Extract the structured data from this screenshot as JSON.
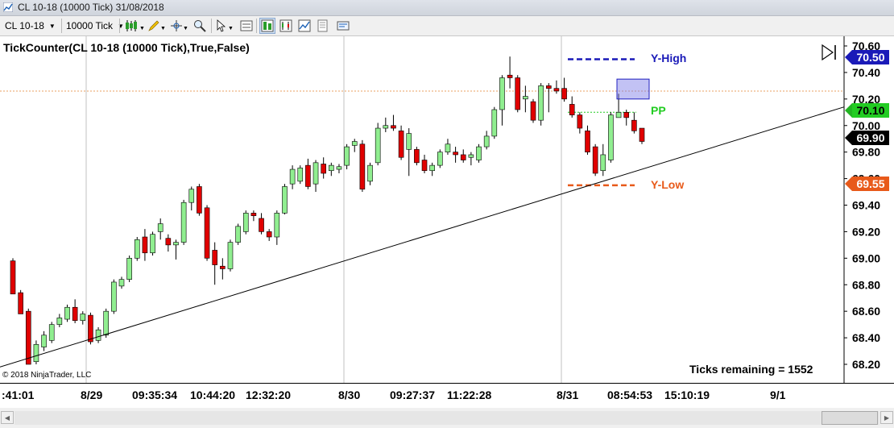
{
  "window": {
    "title": "CL 10-18 (10000 Tick)  31/08/2018"
  },
  "toolbar": {
    "instrument": "CL 10-18",
    "interval": "10000 Tick",
    "tools": [
      "candlestick-style-icon",
      "pencil-draw-icon",
      "crosshair-icon",
      "zoom-icon",
      "pointer-icon",
      "data-box-icon",
      "chart-trader-icon",
      "strategy-icon",
      "indicators-icon",
      "properties-icon"
    ]
  },
  "chart": {
    "title": "TickCounter(CL 10-18 (10000 Tick),True,False)",
    "copyright": "© 2018 NinjaTrader, LLC",
    "ticks_remaining": "Ticks remaining = 1552",
    "price_labels": [
      "70.60",
      "70.40",
      "70.20",
      "70.00",
      "69.80",
      "69.60",
      "69.40",
      "69.20",
      "69.00",
      "68.80",
      "68.60",
      "68.40",
      "68.20"
    ],
    "time_labels": [
      ":41:01",
      "8/29",
      "09:35:34",
      "10:44:20",
      "12:32:20",
      "8/30",
      "09:27:37",
      "11:22:28",
      "8/31",
      "08:54:53",
      "15:10:19",
      "9/1"
    ],
    "markers": {
      "y_high": {
        "label": "Y-High",
        "value": "70.50",
        "color": "#1a1ab8"
      },
      "pp": {
        "label": "PP",
        "value": "70.10",
        "color": "#22b422"
      },
      "last": {
        "value": "69.90",
        "color": "#000000"
      },
      "y_low": {
        "label": "Y-Low",
        "value": "69.55",
        "color": "#e85a1a"
      }
    },
    "colors": {
      "up": "#90ee90",
      "down": "#e00000",
      "wick": "#000000"
    }
  },
  "chart_data": {
    "type": "candlestick",
    "title": "TickCounter(CL 10-18 (10000 Tick),True,False)",
    "ylim": [
      68.1,
      70.65
    ],
    "y_ticks": [
      70.6,
      70.4,
      70.2,
      70.0,
      69.8,
      69.6,
      69.4,
      69.2,
      69.0,
      68.8,
      68.6,
      68.4,
      68.2
    ],
    "x_labels": [
      ":41:01",
      "8/29",
      "09:35:34",
      "10:44:20",
      "12:32:20",
      "8/30",
      "09:27:37",
      "11:22:28",
      "8/31",
      "08:54:53",
      "15:10:19",
      "9/1"
    ],
    "candles": [
      [
        68.98,
        69.0,
        68.75,
        68.73
      ],
      [
        68.74,
        68.76,
        68.6,
        68.58
      ],
      [
        68.6,
        68.62,
        68.22,
        68.2
      ],
      [
        68.22,
        68.38,
        68.2,
        68.35
      ],
      [
        68.33,
        68.45,
        68.3,
        68.42
      ],
      [
        68.38,
        68.52,
        68.36,
        68.5
      ],
      [
        68.5,
        68.58,
        68.48,
        68.55
      ],
      [
        68.54,
        68.65,
        68.52,
        68.63
      ],
      [
        68.63,
        68.69,
        68.51,
        68.53
      ],
      [
        68.53,
        68.6,
        68.5,
        68.58
      ],
      [
        68.57,
        68.59,
        68.35,
        68.37
      ],
      [
        68.38,
        68.48,
        68.36,
        68.46
      ],
      [
        68.42,
        68.62,
        68.4,
        68.6
      ],
      [
        68.6,
        68.84,
        68.58,
        68.82
      ],
      [
        68.79,
        68.86,
        68.77,
        68.84
      ],
      [
        68.84,
        69.02,
        68.82,
        69.0
      ],
      [
        69.0,
        69.16,
        68.98,
        69.14
      ],
      [
        69.16,
        69.22,
        68.98,
        69.04
      ],
      [
        69.04,
        69.2,
        69.02,
        69.18
      ],
      [
        69.2,
        69.3,
        69.14,
        69.26
      ],
      [
        69.15,
        69.18,
        69.05,
        69.1
      ],
      [
        69.1,
        69.14,
        68.99,
        69.12
      ],
      [
        69.12,
        69.44,
        69.1,
        69.42
      ],
      [
        69.42,
        69.54,
        69.36,
        69.52
      ],
      [
        69.54,
        69.56,
        69.32,
        69.34
      ],
      [
        69.38,
        69.4,
        68.98,
        69.0
      ],
      [
        69.06,
        69.12,
        68.8,
        68.95
      ],
      [
        68.94,
        69.0,
        68.84,
        68.92
      ],
      [
        68.92,
        69.14,
        68.9,
        69.12
      ],
      [
        69.12,
        69.26,
        69.1,
        69.24
      ],
      [
        69.2,
        69.36,
        69.18,
        69.34
      ],
      [
        69.34,
        69.36,
        69.28,
        69.32
      ],
      [
        69.3,
        69.34,
        69.18,
        69.2
      ],
      [
        69.2,
        69.22,
        69.13,
        69.16
      ],
      [
        69.16,
        69.36,
        69.1,
        69.34
      ],
      [
        69.34,
        69.56,
        69.33,
        69.54
      ],
      [
        69.56,
        69.7,
        69.52,
        69.67
      ],
      [
        69.58,
        69.7,
        69.56,
        69.68
      ],
      [
        69.7,
        69.75,
        69.52,
        69.54
      ],
      [
        69.56,
        69.74,
        69.5,
        69.72
      ],
      [
        69.71,
        69.76,
        69.6,
        69.64
      ],
      [
        69.66,
        69.72,
        69.62,
        69.7
      ],
      [
        69.67,
        69.71,
        69.64,
        69.69
      ],
      [
        69.7,
        69.86,
        69.67,
        69.84
      ],
      [
        69.85,
        69.9,
        69.8,
        69.88
      ],
      [
        69.86,
        69.89,
        69.5,
        69.52
      ],
      [
        69.58,
        69.72,
        69.55,
        69.7
      ],
      [
        69.72,
        70.02,
        69.7,
        69.98
      ],
      [
        69.98,
        70.06,
        69.95,
        70.0
      ],
      [
        70.0,
        70.08,
        69.96,
        69.98
      ],
      [
        69.96,
        70.0,
        69.74,
        69.76
      ],
      [
        69.82,
        69.98,
        69.62,
        69.94
      ],
      [
        69.82,
        69.84,
        69.7,
        69.72
      ],
      [
        69.74,
        69.78,
        69.64,
        69.66
      ],
      [
        69.66,
        69.72,
        69.62,
        69.7
      ],
      [
        69.7,
        69.82,
        69.68,
        69.8
      ],
      [
        69.8,
        69.9,
        69.78,
        69.86
      ],
      [
        69.8,
        69.84,
        69.72,
        69.78
      ],
      [
        69.78,
        69.82,
        69.72,
        69.74
      ],
      [
        69.76,
        69.8,
        69.7,
        69.78
      ],
      [
        69.74,
        69.86,
        69.72,
        69.84
      ],
      [
        69.84,
        69.96,
        69.82,
        69.92
      ],
      [
        69.92,
        70.14,
        69.9,
        70.12
      ],
      [
        70.12,
        70.38,
        70.0,
        70.36
      ],
      [
        70.38,
        70.52,
        70.28,
        70.36
      ],
      [
        70.36,
        70.38,
        70.1,
        70.12
      ],
      [
        70.2,
        70.3,
        70.1,
        70.22
      ],
      [
        70.18,
        70.2,
        70.02,
        70.04
      ],
      [
        70.04,
        70.32,
        70.0,
        70.3
      ],
      [
        70.3,
        70.32,
        70.1,
        70.28
      ],
      [
        70.28,
        70.34,
        70.24,
        70.26
      ],
      [
        70.28,
        70.36,
        70.18,
        70.2
      ],
      [
        70.16,
        70.22,
        70.06,
        70.08
      ],
      [
        70.08,
        70.1,
        69.94,
        69.98
      ],
      [
        69.96,
        70.0,
        69.78,
        69.8
      ],
      [
        69.84,
        69.86,
        69.62,
        69.64
      ],
      [
        69.66,
        69.86,
        69.62,
        69.78
      ],
      [
        69.74,
        70.1,
        69.72,
        70.08
      ],
      [
        70.06,
        70.24,
        70.06,
        70.1
      ],
      [
        70.1,
        70.12,
        70.0,
        70.06
      ],
      [
        70.04,
        70.1,
        69.94,
        69.96
      ],
      [
        69.98,
        69.98,
        69.86,
        69.88
      ]
    ],
    "trendline": {
      "from": [
        ":41:01",
        68.18
      ],
      "to": [
        "end",
        70.14
      ]
    },
    "levels": [
      {
        "name": "Y-High",
        "value": 70.5
      },
      {
        "name": "PP",
        "value": 70.1
      },
      {
        "name": "Y-Low",
        "value": 69.55
      }
    ],
    "box": {
      "top": 70.35,
      "bottom": 70.2
    },
    "last_price": 69.9
  }
}
